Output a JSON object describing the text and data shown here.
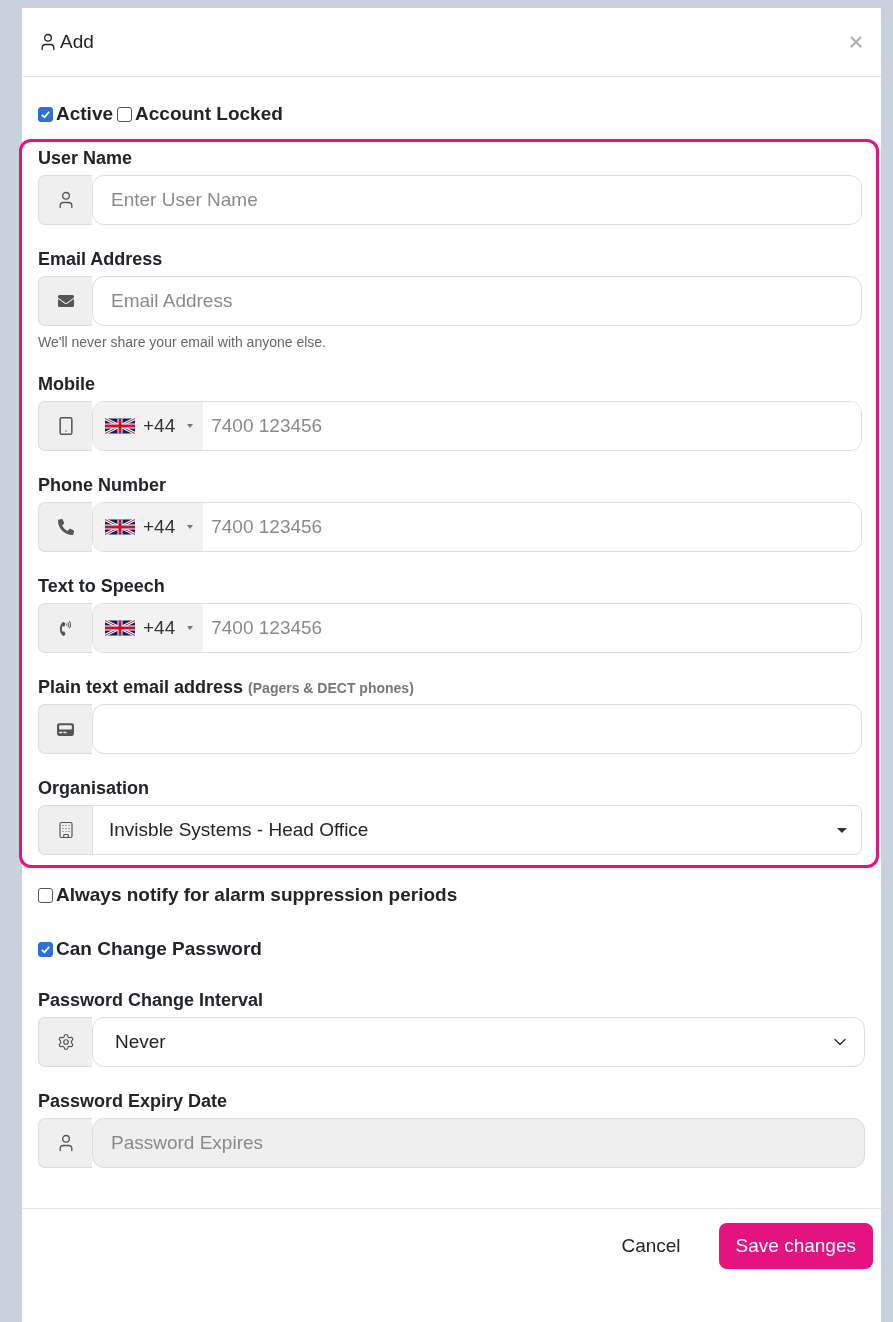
{
  "dialog": {
    "title": "Add"
  },
  "status_checks": [
    {
      "label": "Active",
      "checked": true
    },
    {
      "label": "Account Locked",
      "checked": false
    }
  ],
  "contact_fields": [
    {
      "kind": "text",
      "label": "User Name",
      "placeholder": "Enter User Name"
    },
    {
      "kind": "text",
      "label": "Email Address",
      "placeholder": "Email Address",
      "help": "We'll never share your email with anyone else."
    },
    {
      "kind": "phone",
      "label": "Mobile",
      "country_code": "+44",
      "placeholder": "7400 123456"
    },
    {
      "kind": "phone",
      "label": "Phone Number",
      "country_code": "+44",
      "placeholder": "7400 123456"
    },
    {
      "kind": "phone",
      "label": "Text to Speech",
      "country_code": "+44",
      "placeholder": "7400 123456"
    },
    {
      "kind": "text",
      "label": "Plain text email address",
      "note": "(Pagers & DECT phones)"
    },
    {
      "kind": "select",
      "label": "Organisation",
      "value": "Invisble Systems - Head Office"
    }
  ],
  "options": [
    {
      "label": "Always notify for alarm suppression periods",
      "checked": false
    },
    {
      "label": "Can Change Password",
      "checked": true
    }
  ],
  "password_fields": [
    {
      "kind": "native-select",
      "label": "Password Change Interval",
      "value": "Never",
      "disabled": false
    },
    {
      "kind": "text",
      "label": "Password Expiry Date",
      "placeholder": "Password Expires",
      "disabled": true
    }
  ],
  "footer": {
    "cancel": "Cancel",
    "save": "Save changes"
  }
}
